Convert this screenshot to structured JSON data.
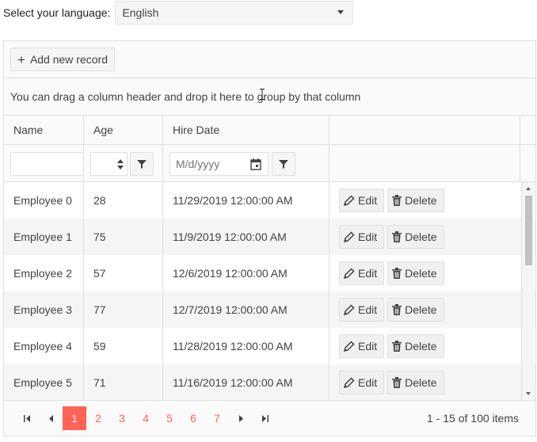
{
  "language": {
    "label": "Select your language:",
    "selected": "English"
  },
  "toolbar": {
    "add_label": "Add new record"
  },
  "group_panel": {
    "hint": "You can drag a column header and drop it here to group by that column"
  },
  "columns": [
    "Name",
    "Age",
    "Hire Date"
  ],
  "filters": {
    "date_placeholder": "M/d/yyyy"
  },
  "rows": [
    {
      "name": "Employee 0",
      "age": "28",
      "hire": "11/29/2019 12:00:00 AM"
    },
    {
      "name": "Employee 1",
      "age": "75",
      "hire": "11/9/2019 12:00:00 AM"
    },
    {
      "name": "Employee 2",
      "age": "57",
      "hire": "12/6/2019 12:00:00 AM"
    },
    {
      "name": "Employee 3",
      "age": "77",
      "hire": "12/7/2019 12:00:00 AM"
    },
    {
      "name": "Employee 4",
      "age": "59",
      "hire": "11/28/2019 12:00:00 AM"
    },
    {
      "name": "Employee 5",
      "age": "71",
      "hire": "11/16/2019 12:00:00 AM"
    }
  ],
  "row_actions": {
    "edit": "Edit",
    "delete": "Delete"
  },
  "pager": {
    "pages": [
      "1",
      "2",
      "3",
      "4",
      "5",
      "6",
      "7"
    ],
    "current": "1",
    "info": "1 - 15 of 100 items"
  },
  "colors": {
    "accent": "#ff6358",
    "border": "#e0e0e0",
    "alt_row": "#f5f5f5"
  },
  "icons": [
    "caret-down-icon",
    "plus-icon",
    "spinner-up-icon",
    "spinner-down-icon",
    "filter-icon",
    "calendar-icon",
    "pencil-icon",
    "trash-icon",
    "page-first-icon",
    "page-prev-icon",
    "page-next-icon",
    "page-last-icon"
  ]
}
